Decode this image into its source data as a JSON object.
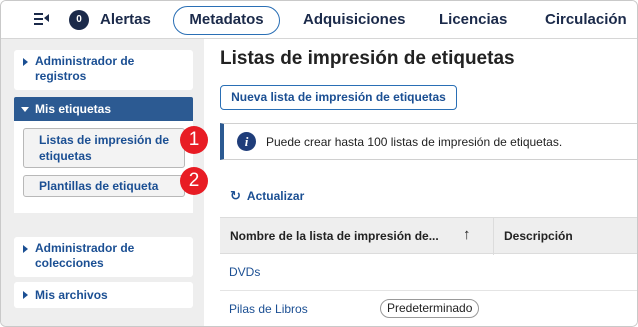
{
  "nav": {
    "alerts_count": "0",
    "alerts_label": "Alertas",
    "items": [
      "Metadatos",
      "Adquisiciones",
      "Licencias",
      "Circulación"
    ],
    "active": "Metadatos"
  },
  "sidebar": {
    "registry_admin": "Administrador de registros",
    "my_labels": "Mis etiquetas",
    "sub_items": [
      "Listas de impresión de etiquetas",
      "Plantillas de etiqueta"
    ],
    "collections_admin": "Administrador de colecciones",
    "my_files": "Mis archivos",
    "callouts": [
      "1",
      "2"
    ]
  },
  "main": {
    "title": "Listas de impresión de etiquetas",
    "new_button": "Nueva lista de impresión de etiquetas",
    "info_icon": "i",
    "info_text": "Puede crear hasta 100 listas de impresión de etiquetas.",
    "refresh_icon": "↻",
    "refresh_label": "Actualizar",
    "columns": [
      "Nombre de la lista de impresión de...",
      "Descripción"
    ],
    "sort_icon": "↑",
    "rows": [
      {
        "name": "DVDs",
        "badge": ""
      },
      {
        "name": "Pilas de Libros",
        "badge": "Predeterminado"
      }
    ]
  },
  "colors": {
    "accent": "#2a6fb5",
    "nav_text": "#1b2a4a",
    "link": "#1b4f93",
    "sidebar_header": "#2c5a92",
    "callout": "#e81c24"
  }
}
